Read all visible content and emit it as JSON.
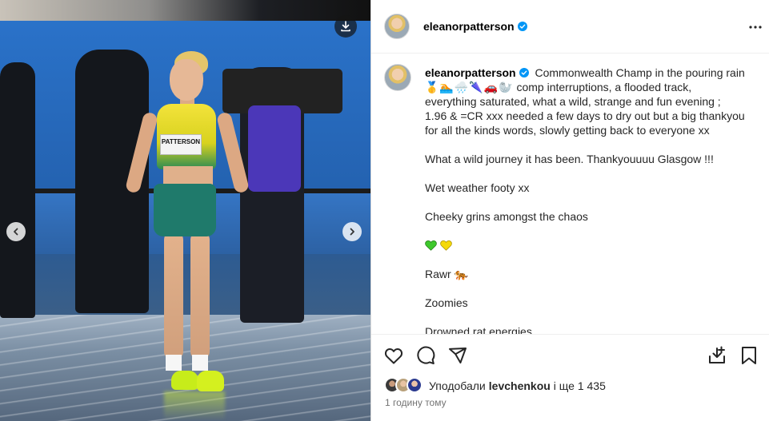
{
  "post": {
    "author": "eleanorpatterson",
    "verified": true,
    "athlete_bib": "PATTERSON",
    "caption_line1": "Commonwealth Champ in the pouring rain",
    "caption_emojis": "🥇🏊🌧️🌂🚗🦭",
    "caption_line1_rest": "comp interruptions, a flooded track, everything saturated, what a wild, strange and fun evening ; 1.96 & =CR xxx needed a few days to dry out but a big thankyou for all the kinds words, slowly getting back to everyone xx",
    "paragraphs": [
      "What a wild journey it has been. Thankyouuuu Glasgow !!!",
      "Wet weather footy xx",
      "Cheeky grins amongst the chaos"
    ],
    "hearts": [
      "green",
      "yellow"
    ],
    "rawr": "Rawr",
    "rawr_emoji": "🐅",
    "zoomies": "Zoomies",
    "drowned": "Drowned rat energies"
  },
  "likes": {
    "prefix": "Уподобали",
    "user": "levchenkou",
    "suffix": "і ще 1 435"
  },
  "timestamp": "1 годину тому",
  "colors": {
    "verified_blue": "#0095f6",
    "green_heart": "#3ec82c",
    "yellow_heart": "#f5d90a",
    "text_primary": "#262626",
    "text_secondary": "#737373"
  },
  "icons": {
    "download": "download-icon",
    "prev": "chevron-left-icon",
    "next": "chevron-right-icon",
    "more": "more-horizontal-icon",
    "like": "heart-outline-icon",
    "comment": "comment-icon",
    "share": "share-icon",
    "save_to_collection": "save-to-collection-icon",
    "bookmark": "bookmark-icon"
  }
}
